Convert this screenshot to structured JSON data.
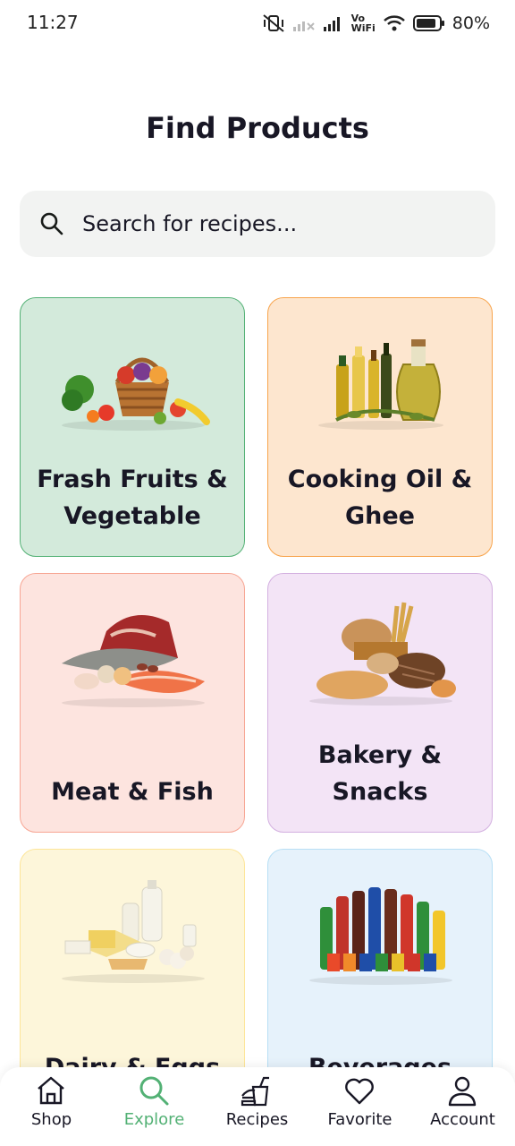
{
  "status_bar": {
    "time": "11:27",
    "battery": "80%",
    "icons": [
      "mute-vibrate-icon",
      "signal-icon",
      "signal-icon",
      "vowifi-icon",
      "wifi-icon",
      "battery-icon"
    ],
    "vowifi_line1": "Vo",
    "vowifi_line2": "WiFi"
  },
  "header": {
    "title": "Find Products"
  },
  "search": {
    "placeholder": "Search for recipes..."
  },
  "categories": [
    {
      "label": "Frash Fruits & Vegetable",
      "bg": "#d3eadb",
      "border": "#53b175",
      "icon": "fruit-basket-image"
    },
    {
      "label": "Cooking Oil & Ghee",
      "bg": "#fde6cf",
      "border": "#f8a44c",
      "icon": "oil-bottles-image"
    },
    {
      "label": "Meat & Fish",
      "bg": "#fde4df",
      "border": "#f7a593",
      "icon": "meat-fish-image"
    },
    {
      "label": "Bakery & Snacks",
      "bg": "#f3e4f6",
      "border": "#d3b0e0",
      "icon": "bakery-image"
    },
    {
      "label": "Dairy & Eggs",
      "bg": "#fdf6da",
      "border": "#fde598",
      "icon": "dairy-eggs-image"
    },
    {
      "label": "Beverages",
      "bg": "#e6f2fb",
      "border": "#b7dff5",
      "icon": "beverages-image"
    }
  ],
  "nav": {
    "active": "Explore",
    "accent": "#53b175",
    "items": [
      {
        "label": "Shop",
        "icon": "store-icon"
      },
      {
        "label": "Explore",
        "icon": "search-icon"
      },
      {
        "label": "Recipes",
        "icon": "burger-drink-icon"
      },
      {
        "label": "Favorite",
        "icon": "heart-icon"
      },
      {
        "label": "Account",
        "icon": "user-icon"
      }
    ]
  }
}
